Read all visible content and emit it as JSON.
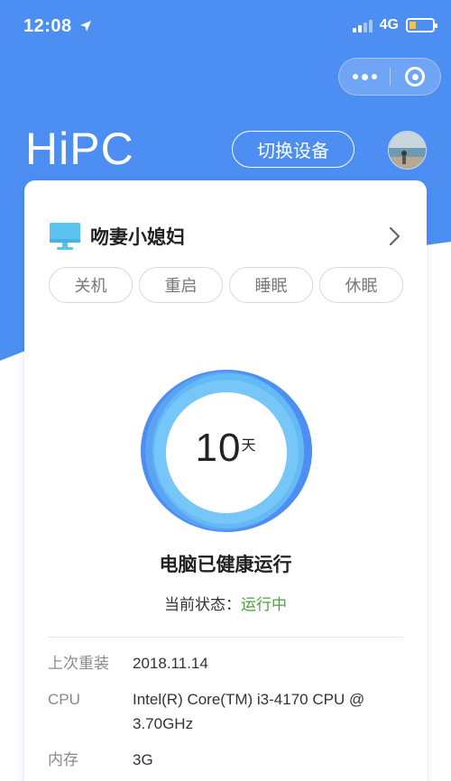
{
  "status_bar": {
    "time": "12:08",
    "network": "4G"
  },
  "header": {
    "app_title": "HiPC",
    "switch_button": "切换设备"
  },
  "device": {
    "name": "吻妻小媳妇"
  },
  "actions": [
    {
      "label": "关机"
    },
    {
      "label": "重启"
    },
    {
      "label": "睡眠"
    },
    {
      "label": "休眠"
    }
  ],
  "uptime": {
    "value": "10",
    "unit": "天"
  },
  "health_text": "电脑已健康运行",
  "state": {
    "label": "当前状态：",
    "value": "运行中"
  },
  "info": [
    {
      "key": "上次重装",
      "value": "2018.11.14"
    },
    {
      "key": "CPU",
      "value": "Intel(R) Core(TM) i3-4170 CPU @ 3.70GHz"
    },
    {
      "key": "内存",
      "value": "3G"
    }
  ],
  "colors": {
    "primary_blue": "#4d8ef2",
    "ring_blue": "#5fb0f5",
    "running_green": "#4ba43a",
    "battery_yellow": "#f3c64a"
  },
  "icons": [
    "location-arrow-icon",
    "signal-icon",
    "battery-icon",
    "more-dots-icon",
    "target-close-icon",
    "monitor-icon",
    "chevron-right-icon"
  ]
}
